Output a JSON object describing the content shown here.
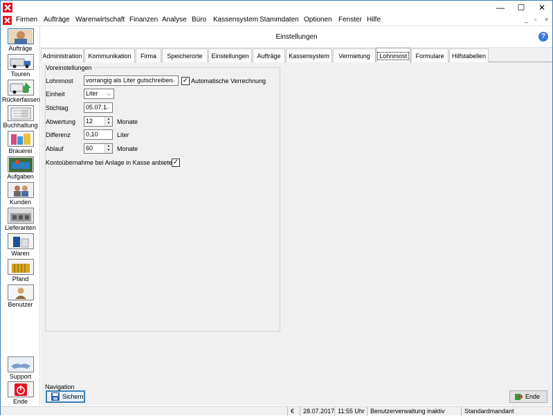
{
  "window": {
    "minimize": "—",
    "maximize": "☐",
    "close": "✕"
  },
  "menubar": {
    "items": [
      "Firmen",
      "Aufträge",
      "Warenwirtschaft",
      "Finanzen",
      "Analyse",
      "Büro",
      "Kassensystem",
      "Stammdaten",
      "Optionen",
      "Fenster",
      "Hilfe"
    ],
    "mdi_minimize": "_",
    "mdi_restore": "▫",
    "mdi_close": "×"
  },
  "sidebar": {
    "items": [
      {
        "label": "Aufträge",
        "icon": "orders-icon"
      },
      {
        "label": "Touren",
        "icon": "truck-icon"
      },
      {
        "label": "Rückerfassen",
        "icon": "return-icon"
      },
      {
        "label": "Buchhaltung",
        "icon": "accounting-icon"
      },
      {
        "label": "Brauerei",
        "icon": "brewery-icon"
      },
      {
        "label": "Aufgaben",
        "icon": "tasks-icon"
      },
      {
        "label": "Kunden",
        "icon": "customers-icon"
      },
      {
        "label": "Lieferanten",
        "icon": "suppliers-icon"
      },
      {
        "label": "Waren",
        "icon": "goods-icon"
      },
      {
        "label": "Pfand",
        "icon": "deposit-icon"
      },
      {
        "label": "Benutzer",
        "icon": "user-icon"
      }
    ],
    "bottom": [
      {
        "label": "Support",
        "icon": "handshake-icon"
      },
      {
        "label": "Ende",
        "icon": "power-icon"
      }
    ]
  },
  "header": {
    "title": "Einstellungen",
    "help": "?"
  },
  "tabs": [
    {
      "label": "Administration",
      "active": false
    },
    {
      "label": "Kommunikation",
      "active": false
    },
    {
      "label": "Firma",
      "active": false
    },
    {
      "label": "Speicherorte",
      "active": false
    },
    {
      "label": "Einstellungen",
      "active": false
    },
    {
      "label": "Aufträge",
      "active": false
    },
    {
      "label": "Kassensystem",
      "active": false
    },
    {
      "label": "Vermietung",
      "active": false
    },
    {
      "label": "Lohnmost",
      "active": true
    },
    {
      "label": "Formulare",
      "active": false
    },
    {
      "label": "Hilfstabellen",
      "active": false
    }
  ],
  "form": {
    "group_title": "Voreinstellungen",
    "lohnmost_label": "Lohnmost",
    "lohnmost_value": "vorrangig als Liter gutschreiben",
    "auto_verrechnung_label": "Automatische Verrechnung",
    "auto_verrechnung_checked": true,
    "einheit_label": "Einheit",
    "einheit_value": "Liter",
    "stichtag_label": "Stichtag",
    "stichtag_value": "05.07.1",
    "abwertung_label": "Abwertung",
    "abwertung_value": "12",
    "abwertung_unit": "Monate",
    "differenz_label": "Differenz",
    "differenz_value": "0,10",
    "differenz_unit": "Liter",
    "ablauf_label": "Ablauf",
    "ablauf_value": "60",
    "ablauf_unit": "Monate",
    "konto_label": "Kontoübernahme bei Anlage in Kasse anbieten",
    "konto_checked": true
  },
  "navigation": {
    "label": "Navigation",
    "save_label": "Sichern",
    "end_label": "Ende"
  },
  "statusbar": {
    "currency": "€",
    "date": "28.07.2017",
    "time": "11:55 Uhr",
    "user_admin": "Benutzerverwaltung inaktiv",
    "mandant": "Standardmandant"
  },
  "colors": {
    "accent": "#3c7fb1",
    "app_red": "#e81123"
  }
}
